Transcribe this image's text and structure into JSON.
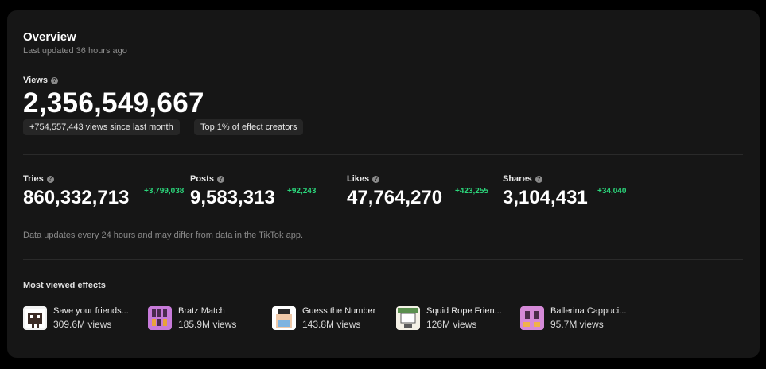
{
  "overview": {
    "title": "Overview",
    "last_updated": "Last updated 36 hours ago"
  },
  "views": {
    "label": "Views",
    "value": "2,356,549,667",
    "badges": [
      "+754,557,443 views since last month",
      "Top 1% of effect creators"
    ]
  },
  "metrics": [
    {
      "label": "Tries",
      "value": "860,332,713",
      "delta": "+3,799,038"
    },
    {
      "label": "Posts",
      "value": "9,583,313",
      "delta": "+92,243"
    },
    {
      "label": "Likes",
      "value": "47,764,270",
      "delta": "+423,255"
    },
    {
      "label": "Shares",
      "value": "3,104,431",
      "delta": "+34,040"
    }
  ],
  "note": "Data updates every 24 hours and may differ from data in the TikTok app.",
  "most_viewed": {
    "title": "Most viewed effects",
    "effects": [
      {
        "name": "Save your friends...",
        "views": "309.6M views"
      },
      {
        "name": "Bratz Match",
        "views": "185.9M views"
      },
      {
        "name": "Guess the Number",
        "views": "143.8M views"
      },
      {
        "name": "Squid Rope Frien...",
        "views": "126M views"
      },
      {
        "name": "Ballerina Cappuci...",
        "views": "95.7M views"
      }
    ]
  },
  "colors": {
    "background": "#000000",
    "card": "#161616",
    "positive_delta": "#2bd67b",
    "chip": "#262626"
  }
}
